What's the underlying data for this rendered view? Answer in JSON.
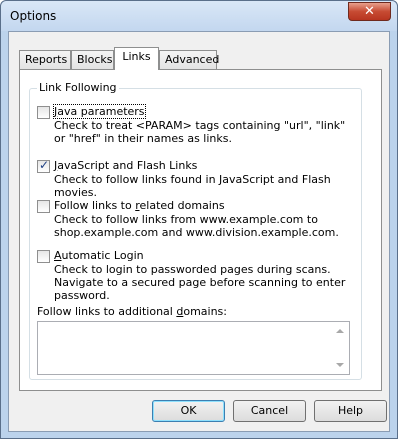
{
  "window": {
    "title": "Options",
    "close_label": "✕"
  },
  "tabs": [
    {
      "label": "Reports",
      "active": false
    },
    {
      "label": "Blocks",
      "active": false
    },
    {
      "label": "Links",
      "active": true
    },
    {
      "label": "Advanced",
      "active": false
    }
  ],
  "group": {
    "label": "Link Following"
  },
  "options": [
    {
      "label_pre": "",
      "label_ul": "J",
      "label_post": "ava parameters",
      "checked": false,
      "description": "Check to treat <PARAM> tags containing \"url\", \"link\" or \"href\" in their names as links."
    },
    {
      "label_pre": "",
      "label_ul": "J",
      "label_post": "avaScript and Flash Links",
      "checked": true,
      "description": "Check to follow links found in JavaScript and Flash movies."
    },
    {
      "label_pre": "Follow links to ",
      "label_ul": "r",
      "label_post": "elated domains",
      "checked": false,
      "description": "Check to follow links from www.example.com to shop.example.com and www.division.example.com."
    },
    {
      "label_pre": "",
      "label_ul": "A",
      "label_post": "utomatic Login",
      "checked": false,
      "description": "Check to login to passworded pages during scans. Navigate to a secured page before scanning to enter password."
    }
  ],
  "additional_domains": {
    "label_pre": "Follow links to additional ",
    "label_ul": "d",
    "label_post": "omains:",
    "value": ""
  },
  "buttons": {
    "ok": "OK",
    "cancel": "Cancel",
    "help": "Help"
  }
}
